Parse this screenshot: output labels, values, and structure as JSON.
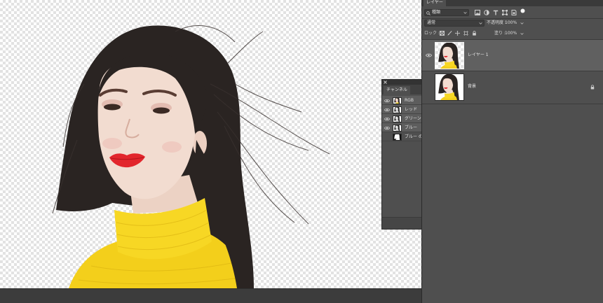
{
  "colors": {
    "panel_bg": "#4f4f4f",
    "selected_row": "#606060",
    "hair": "#2a2422",
    "skin": "#f2dcd0",
    "lips": "#e2262c",
    "sweater": "#f3cf1b",
    "collar": "#f7d724"
  },
  "layers_panel": {
    "tab_label": "レイヤー",
    "filter": {
      "kind_label": "種類",
      "search_icon": "search-icon",
      "filter_icons": [
        "image-filter-icon",
        "adjustment-filter-icon",
        "type-filter-icon",
        "shape-filter-icon",
        "smart-object-filter-icon"
      ],
      "toggle_icon": "filter-toggle-icon"
    },
    "blend_mode": "通常",
    "opacity": {
      "label": "不透明度 :",
      "value": "100%"
    },
    "lock": {
      "label": "ロック :",
      "icons": [
        "lock-transparent-pixels-icon",
        "lock-image-pixels-icon",
        "lock-position-icon",
        "lock-artboard-icon",
        "lock-all-icon"
      ]
    },
    "fill": {
      "label": "塗り :",
      "value": "100%"
    },
    "layers": [
      {
        "name": "レイヤー 1",
        "visible": true,
        "selected": true,
        "locked": false
      },
      {
        "name": "背景",
        "visible": false,
        "selected": false,
        "locked": true
      }
    ]
  },
  "channels_panel": {
    "tab_label": "チャンネル",
    "channels": [
      {
        "name": "RGB",
        "visible": true,
        "active": true
      },
      {
        "name": "レッド",
        "visible": true,
        "active": true
      },
      {
        "name": "グリーン",
        "visible": true,
        "active": true
      },
      {
        "name": "ブルー",
        "visible": true,
        "active": true
      },
      {
        "name": "ブルー の",
        "visible": false,
        "active": false
      }
    ]
  }
}
